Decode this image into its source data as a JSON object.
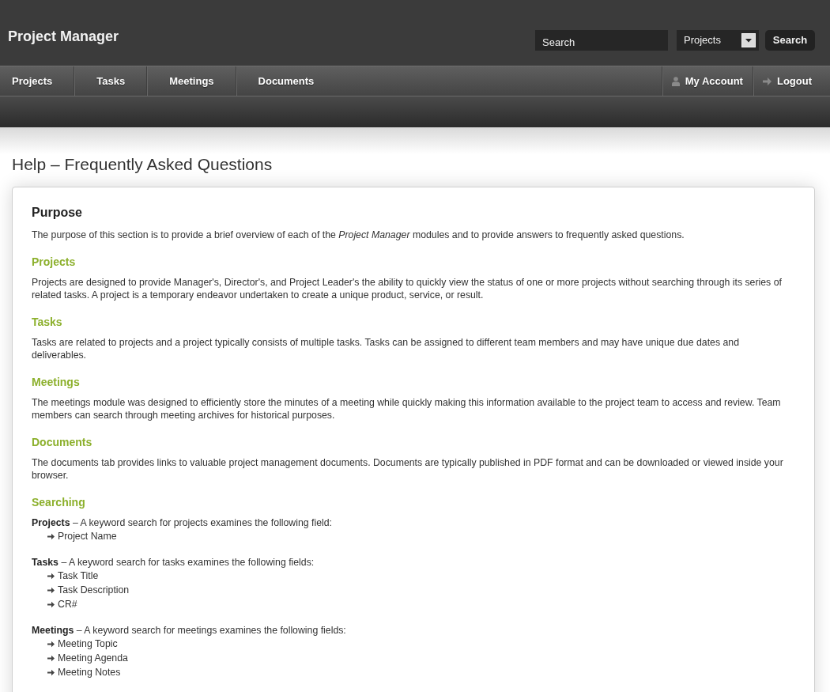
{
  "header": {
    "title": "Project Manager",
    "search": {
      "placeholder": "Search"
    },
    "scope_select": {
      "value": "Projects"
    },
    "search_button": "Search"
  },
  "nav": {
    "items": [
      {
        "label": "Projects"
      },
      {
        "label": "Tasks"
      },
      {
        "label": "Meetings"
      },
      {
        "label": "Documents"
      }
    ],
    "account_links": [
      {
        "label": "My Account",
        "kind": "account"
      },
      {
        "label": "Logout",
        "kind": "logout"
      }
    ]
  },
  "page_title": "Help – Frequently Asked Questions",
  "faq": {
    "heading": "Purpose",
    "intro": "The purpose of this section is to provide a brief overview of each of the *Project Manager* modules and to provide answers to frequently asked questions.",
    "sections": [
      {
        "heading": "Projects",
        "text": "Projects are designed to provide Manager's, Director's, and Project Leader's the ability to quickly view the status of one or more projects without searching through its series of related tasks. A project is a temporary endeavor undertaken to create a unique product, service, or result."
      },
      {
        "heading": "Tasks",
        "text": "Tasks are related to projects and a project typically consists of multiple tasks. Tasks can be assigned to different team members and may have unique due dates and deliverables."
      },
      {
        "heading": "Meetings",
        "text": "The meetings module was designed to efficiently store the minutes of a meeting while quickly making this information available to the project team to access and review. Team members can search through meeting archives for historical purposes."
      },
      {
        "heading": "Documents",
        "text": "The documents tab provides links to valuable project management documents. Documents are typically published in PDF format and can be downloaded or viewed inside your browser."
      }
    ],
    "searching": {
      "heading": "Searching",
      "groups": [
        {
          "text": "**Projects** – A keyword search for projects examines the following field:",
          "fields": [
            "Project Name"
          ]
        },
        {
          "text": "**Tasks** – A keyword search for tasks examines the following fields:",
          "fields": [
            "Task Title",
            "Task Description",
            "CR#"
          ]
        },
        {
          "text": "**Meetings** – A keyword search for meetings examines the following fields:",
          "fields": [
            "Meeting Topic",
            "Meeting Agenda",
            "Meeting Notes"
          ]
        }
      ]
    }
  }
}
